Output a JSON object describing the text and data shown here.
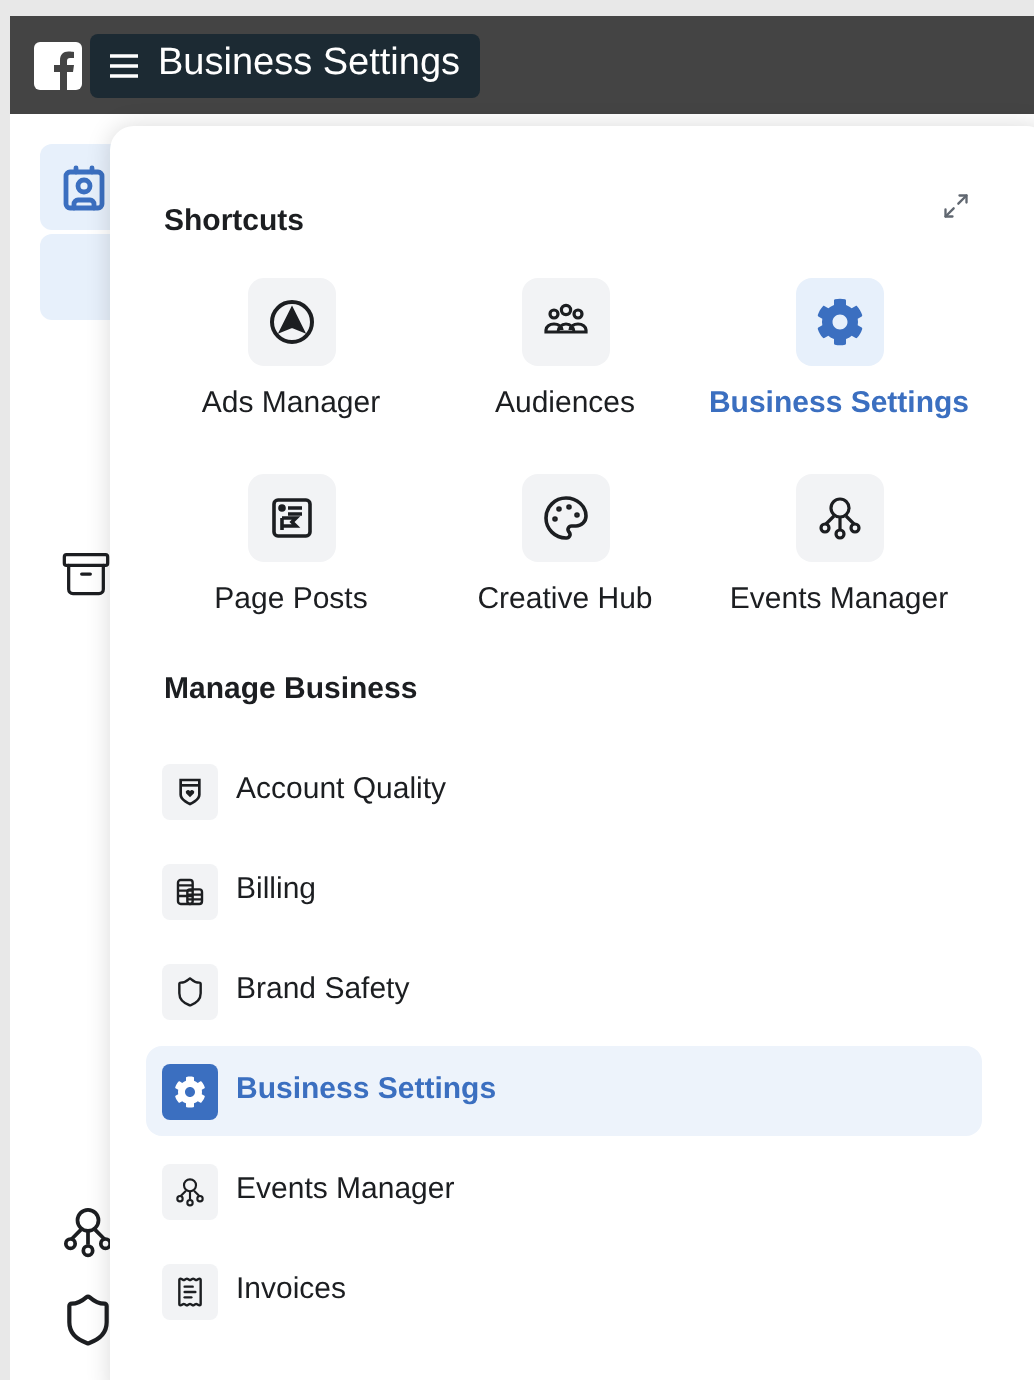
{
  "header": {
    "title": "Business Settings"
  },
  "shortcuts": {
    "title": "Shortcuts",
    "items": [
      {
        "label": "Ads Manager",
        "kind": "ads",
        "selected": false
      },
      {
        "label": "Audiences",
        "kind": "audiences",
        "selected": false
      },
      {
        "label": "Business Settings",
        "kind": "gear",
        "selected": true
      },
      {
        "label": "Page Posts",
        "kind": "posts",
        "selected": false
      },
      {
        "label": "Creative Hub",
        "kind": "palette",
        "selected": false
      },
      {
        "label": "Events Manager",
        "kind": "events",
        "selected": false
      }
    ]
  },
  "manage_business": {
    "title": "Manage Business",
    "items": [
      {
        "label": "Account Quality",
        "kind": "quality",
        "selected": false
      },
      {
        "label": "Billing",
        "kind": "billing",
        "selected": false
      },
      {
        "label": "Brand Safety",
        "kind": "shield",
        "selected": false
      },
      {
        "label": "Business Settings",
        "kind": "gear",
        "selected": true
      },
      {
        "label": "Events Manager",
        "kind": "events",
        "selected": false
      },
      {
        "label": "Invoices",
        "kind": "invoice",
        "selected": false
      }
    ]
  }
}
